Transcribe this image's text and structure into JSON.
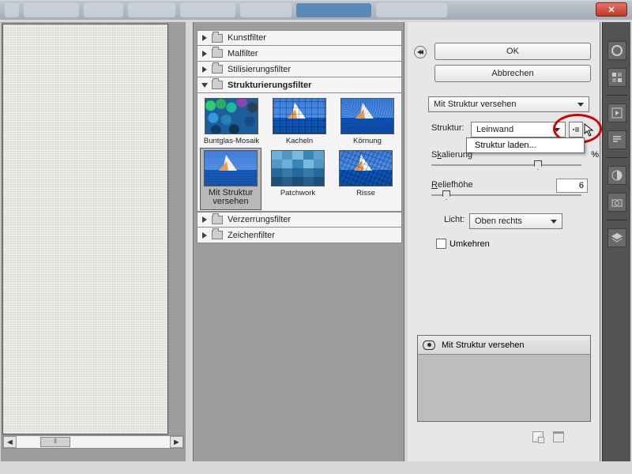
{
  "window": {
    "close_glyph": "✕"
  },
  "buttons": {
    "ok": "OK",
    "cancel": "Abbrechen"
  },
  "filter_dropdown": "Mit Struktur versehen",
  "struktur": {
    "label": "Struktur:",
    "value": "Leinwand",
    "menu_load": "Struktur laden..."
  },
  "skalierung": {
    "label_html": "Skalierung",
    "pct": "%"
  },
  "relief": {
    "label": "Reliefhöhe",
    "value": "6"
  },
  "licht": {
    "label": "Licht:",
    "value": "Oben rechts"
  },
  "umkehren": "Umkehren",
  "layers": {
    "row0": "Mit Struktur versehen"
  },
  "tree": {
    "kunstfilter": "Kunstfilter",
    "malfilter": "Malfilter",
    "stilisierung": "Stilisierungsfilter",
    "strukturierung": "Strukturierungsfilter",
    "verzerrung": "Verzerrungsfilter",
    "zeichen": "Zeichenfilter"
  },
  "thumbs": {
    "buntglas": "Buntglas-Mosaik",
    "kacheln": "Kacheln",
    "koernung": "Körnung",
    "mitstruktur_l1": "Mit Struktur",
    "mitstruktur_l2": "versehen",
    "patchwork": "Patchwork",
    "risse": "Risse"
  },
  "scroll_thumb_glyph": "⦀"
}
